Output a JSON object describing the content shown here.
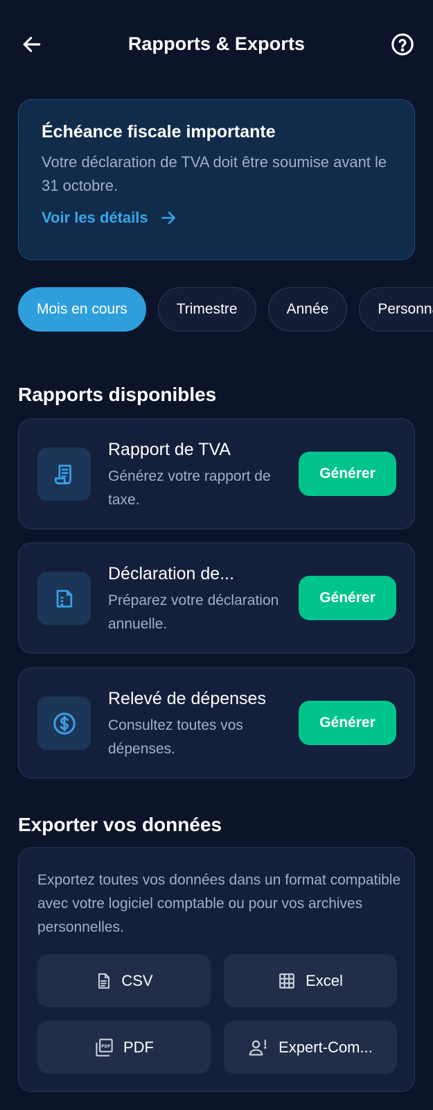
{
  "header": {
    "title": "Rapports & Exports",
    "back_icon": "arrow-left-icon",
    "help_icon": "help-circle-icon"
  },
  "alert": {
    "title": "Échéance fiscale importante",
    "text": "Votre déclaration de TVA doit être soumise avant le 31 octobre.",
    "link_label": "Voir les détails",
    "link_icon": "arrow-right-icon"
  },
  "filters": {
    "chips": [
      {
        "label": "Mois en cours",
        "active": true
      },
      {
        "label": "Trimestre",
        "active": false
      },
      {
        "label": "Année",
        "active": false
      },
      {
        "label": "Personnalisé",
        "active": false
      }
    ]
  },
  "reports": {
    "section_title": "Rapports disponibles",
    "items": [
      {
        "title": "Rapport de TVA",
        "description": "Générez votre rapport de taxe.",
        "button_label": "Générer",
        "icon": "receipt-icon"
      },
      {
        "title": "Déclaration de...",
        "description": "Préparez votre déclaration annuelle.",
        "button_label": "Générer",
        "icon": "document-icon"
      },
      {
        "title": "Relevé de dépenses",
        "description": "Consultez toutes vos dépenses.",
        "button_label": "Générer",
        "icon": "dollar-circle-icon"
      }
    ]
  },
  "export": {
    "section_title": "Exporter vos données",
    "description": "Exportez toutes vos données dans un format compatible avec votre logiciel comptable ou pour vos archives personnelles.",
    "buttons": [
      {
        "label": "CSV",
        "icon": "file-text-icon"
      },
      {
        "label": "Excel",
        "icon": "grid-icon"
      },
      {
        "label": "PDF",
        "icon": "pdf-icon"
      },
      {
        "label": "Expert-Com...",
        "icon": "user-alert-icon"
      }
    ]
  },
  "colors": {
    "background": "#0b1429",
    "accent_blue": "#2f9fdc",
    "accent_green": "#00c48c",
    "link_blue": "#36a7e6"
  }
}
